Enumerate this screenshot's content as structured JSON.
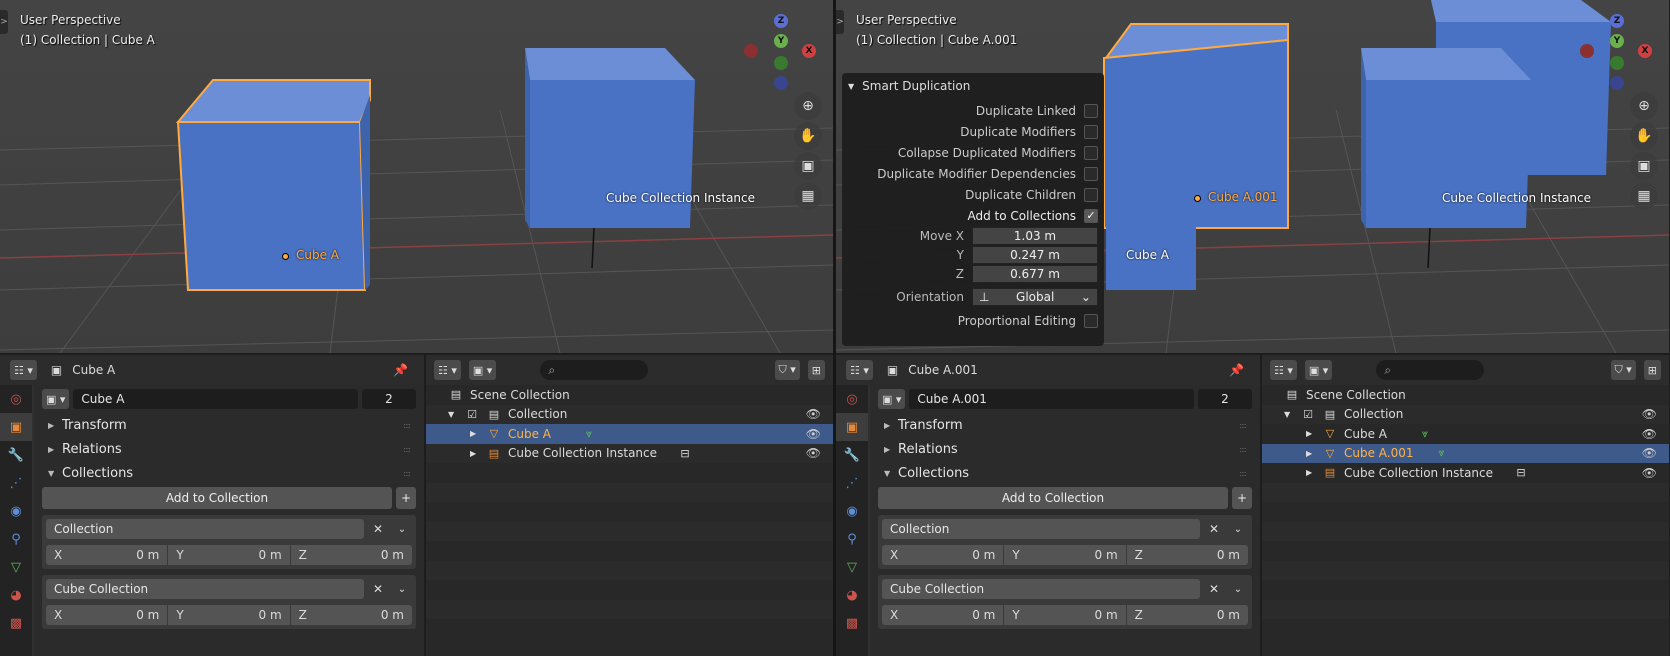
{
  "left": {
    "viewport": {
      "mode": "User Perspective",
      "context": "(1) Collection | Cube A",
      "labels": {
        "active": "Cube A",
        "instance": "Cube Collection Instance"
      },
      "gizmo": {
        "z": "Z",
        "y": "Y",
        "x": "X"
      }
    },
    "properties": {
      "object_name": "Cube A",
      "data_name": "Cube A",
      "users": "2",
      "panels": [
        "Transform",
        "Relations",
        "Collections"
      ],
      "add_to_collection": "Add to Collection",
      "collections": [
        {
          "name": "Collection",
          "x_label": "X",
          "x": "0 m",
          "y_label": "Y",
          "y": "0 m",
          "z_label": "Z",
          "z": "0 m"
        },
        {
          "name": "Cube Collection",
          "x_label": "X",
          "x": "0 m",
          "y_label": "Y",
          "y": "0 m",
          "z_label": "Z",
          "z": "0 m"
        }
      ]
    },
    "outliner": {
      "rows": [
        "Scene Collection",
        "Collection",
        "Cube A",
        "Cube Collection Instance"
      ]
    }
  },
  "right": {
    "viewport": {
      "mode": "User Perspective",
      "context": "(1) Collection | Cube A.001",
      "labels": {
        "active": "Cube A.001",
        "original": "Cube A",
        "instance": "Cube Collection Instance"
      },
      "gizmo": {
        "z": "Z",
        "y": "Y",
        "x": "X"
      }
    },
    "redo": {
      "title": "Smart Duplication",
      "options": [
        {
          "label": "Duplicate Linked",
          "checked": false
        },
        {
          "label": "Duplicate Modifiers",
          "checked": false
        },
        {
          "label": "Collapse Duplicated Modifiers",
          "checked": false
        },
        {
          "label": "Duplicate Modifier Dependencies",
          "checked": false
        },
        {
          "label": "Duplicate Children",
          "checked": false
        },
        {
          "label": "Add to Collections",
          "checked": true
        }
      ],
      "move_x_label": "Move X",
      "move_x": "1.03 m",
      "move_y_label": "Y",
      "move_y": "0.247 m",
      "move_z_label": "Z",
      "move_z": "0.677 m",
      "orientation_label": "Orientation",
      "orientation": "Global",
      "proportional_label": "Proportional Editing"
    },
    "properties": {
      "object_name": "Cube A.001",
      "data_name": "Cube A.001",
      "users": "2",
      "panels": [
        "Transform",
        "Relations",
        "Collections"
      ],
      "add_to_collection": "Add to Collection",
      "collections": [
        {
          "name": "Collection",
          "x_label": "X",
          "x": "0 m",
          "y_label": "Y",
          "y": "0 m",
          "z_label": "Z",
          "z": "0 m"
        },
        {
          "name": "Cube Collection",
          "x_label": "X",
          "x": "0 m",
          "y_label": "Y",
          "y": "0 m",
          "z_label": "Z",
          "z": "0 m"
        }
      ]
    },
    "outliner": {
      "rows": [
        "Scene Collection",
        "Collection",
        "Cube A",
        "Cube A.001",
        "Cube Collection Instance"
      ]
    }
  },
  "colors": {
    "cube": "#4a72c4",
    "selection": "#ffaa40",
    "highlight_row": "#3d5a8a"
  }
}
